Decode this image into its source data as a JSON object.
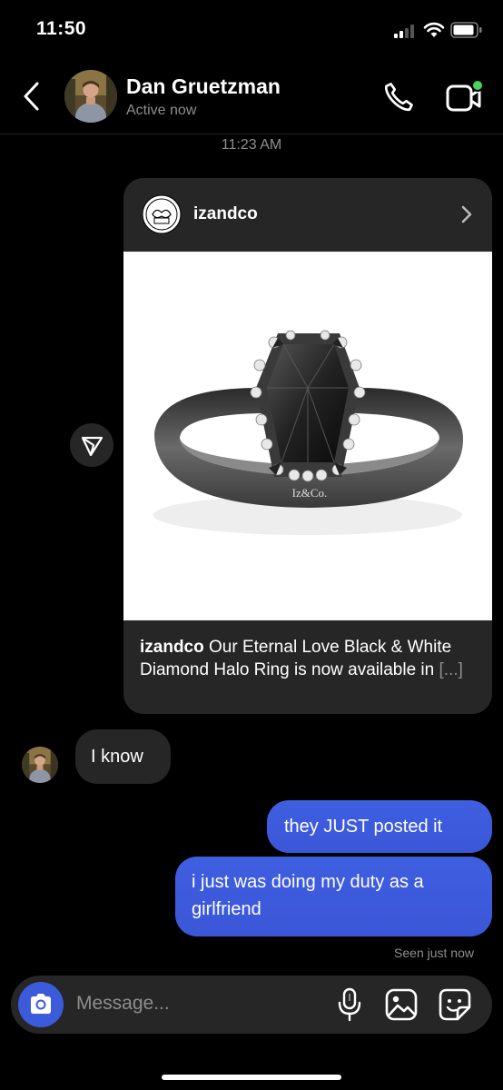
{
  "status_bar": {
    "time": "11:50"
  },
  "header": {
    "name": "Dan Gruetzman",
    "status": "Active now"
  },
  "thread": {
    "timestamp": "11:23 AM",
    "shared_post": {
      "account": "izandco",
      "caption_user": "izandco",
      "caption_text": " Our Eternal Love Black & White Diamond Halo Ring is now available in ",
      "caption_more": "[...]",
      "ring_engraving": "Iz&Co."
    },
    "messages": [
      {
        "from": "other",
        "text": "I know"
      },
      {
        "from": "me",
        "text": "they JUST posted it"
      },
      {
        "from": "me",
        "text": "i just was doing my duty as a girlfriend"
      }
    ],
    "seen": "Seen just now"
  },
  "composer": {
    "placeholder": "Message..."
  },
  "colors": {
    "accent": "#3b5bdb",
    "bubble_incoming": "#262626",
    "online": "#4ad35c"
  }
}
